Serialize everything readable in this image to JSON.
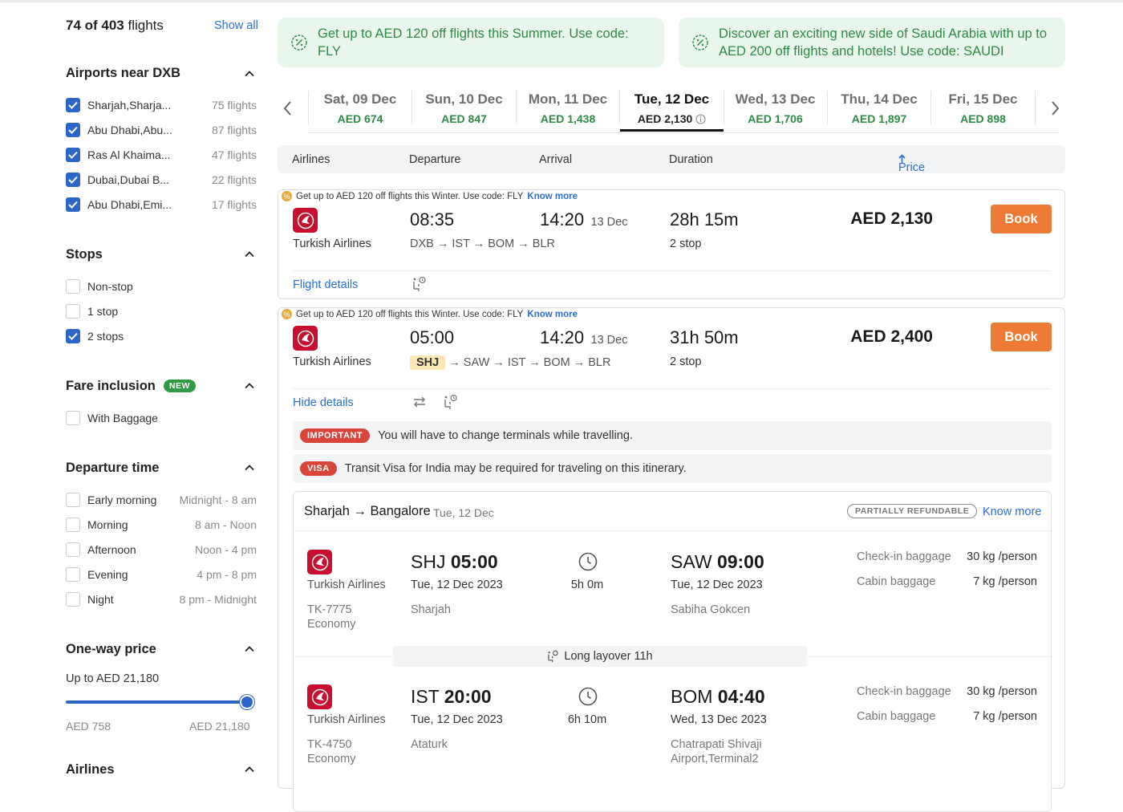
{
  "sidebar": {
    "count": {
      "shown": "74 of 403",
      "suffix": "flights"
    },
    "show_all": "Show all",
    "airports": {
      "title": "Airports near DXB",
      "items": [
        {
          "label": "Sharjah,Sharja...",
          "count": "75 flights",
          "checked": true
        },
        {
          "label": "Abu Dhabi,Abu...",
          "count": "87 flights",
          "checked": true
        },
        {
          "label": "Ras Al Khaima...",
          "count": "47 flights",
          "checked": true
        },
        {
          "label": "Dubai,Dubai B...",
          "count": "22 flights",
          "checked": true
        },
        {
          "label": "Abu Dhabi,Emi...",
          "count": "17 flights",
          "checked": true
        }
      ]
    },
    "stops": {
      "title": "Stops",
      "items": [
        {
          "label": "Non-stop",
          "checked": false
        },
        {
          "label": "1 stop",
          "checked": false
        },
        {
          "label": "2 stops",
          "checked": true
        }
      ]
    },
    "fare": {
      "title": "Fare inclusion",
      "badge": "NEW",
      "items": [
        {
          "label": "With Baggage",
          "checked": false
        }
      ]
    },
    "departure": {
      "title": "Departure time",
      "items": [
        {
          "label": "Early morning",
          "range": "Midnight - 8 am"
        },
        {
          "label": "Morning",
          "range": "8 am - Noon"
        },
        {
          "label": "Afternoon",
          "range": "Noon - 4 pm"
        },
        {
          "label": "Evening",
          "range": "4 pm - 8 pm"
        },
        {
          "label": "Night",
          "range": "8 pm - Midnight"
        }
      ]
    },
    "price": {
      "title": "One-way price",
      "upto": "Up to AED 21,180",
      "min": "AED 758",
      "max": "AED 21,180",
      "slider_fraction": 1.0
    },
    "airlines_title": "Airlines"
  },
  "promos": [
    {
      "text": "Get up to AED 120 off flights this Summer. Use code: FLY"
    },
    {
      "text": "Discover an exciting new side of Saudi Arabia with up to AED 200 off flights and hotels! Use code: SAUDI"
    }
  ],
  "dates": [
    {
      "day": "Sat, 09 Dec",
      "price": "AED 674"
    },
    {
      "day": "Sun, 10 Dec",
      "price": "AED 847"
    },
    {
      "day": "Mon, 11 Dec",
      "price": "AED 1,438"
    },
    {
      "day": "Tue, 12 Dec",
      "price": "AED 2,130",
      "selected": true
    },
    {
      "day": "Wed, 13 Dec",
      "price": "AED 1,706"
    },
    {
      "day": "Thu, 14 Dec",
      "price": "AED 1,897"
    },
    {
      "day": "Fri, 15 Dec",
      "price": "AED 898"
    }
  ],
  "header": {
    "airlines": "Airlines",
    "departure": "Departure",
    "arrival": "Arrival",
    "duration": "Duration",
    "price": "Price"
  },
  "offer": {
    "text": "Get up to AED 120 off flights this Winter. Use code: FLY",
    "link": "Know more"
  },
  "flights": [
    {
      "airline": "Turkish Airlines",
      "dep": "08:35",
      "arr": "14:20",
      "arr_date": "13 Dec",
      "route": "DXB → IST → BOM → BLR",
      "duration": "28h 15m",
      "stops": "2 stop",
      "price": "AED 2,130",
      "book": "Book",
      "details_link": "Flight details"
    },
    {
      "airline": "Turkish Airlines",
      "dep": "05:00",
      "arr": "14:20",
      "arr_date": "13 Dec",
      "route_origin": "SHJ",
      "route_rest": "→ SAW → IST → BOM → BLR",
      "duration": "31h 50m",
      "stops": "2 stop",
      "price": "AED 2,400",
      "book": "Book",
      "details_link": "Hide details",
      "notices": [
        {
          "tag": "IMPORTANT",
          "color": "#d9453b",
          "text": "You will have to change terminals while travelling."
        },
        {
          "tag": "VISA",
          "color": "#d9453b",
          "text": "Transit Visa for India may be required for traveling on this itinerary."
        }
      ],
      "itinerary": {
        "route": "Sharjah → Bangalore",
        "date": "Tue, 12 Dec",
        "refund": "PARTIALLY REFUNDABLE",
        "know_more": "Know more",
        "layover": "Long layover 11h",
        "segments": [
          {
            "airline": "Turkish Airlines",
            "flight": "TK-7775",
            "cabin": "Economy",
            "from_code": "SHJ",
            "from_time": "05:00",
            "from_date": "Tue, 12 Dec 2023",
            "from_city": "Sharjah",
            "duration": "5h 0m",
            "to_code": "SAW",
            "to_time": "09:00",
            "to_date": "Tue, 12 Dec 2023",
            "to_city": "Sabiha Gokcen",
            "checkin_label": "Check-in baggage",
            "checkin": "30 kg /person",
            "cabin_label": "Cabin baggage",
            "cabin_bag": "7 kg /person"
          },
          {
            "airline": "Turkish Airlines",
            "flight": "TK-4750",
            "cabin": "Economy",
            "from_code": "IST",
            "from_time": "20:00",
            "from_date": "Tue, 12 Dec 2023",
            "from_city": "Ataturk",
            "duration": "6h 10m",
            "to_code": "BOM",
            "to_time": "04:40",
            "to_date": "Wed, 13 Dec 2023",
            "to_city": "Chatrapati Shivaji",
            "to_city2": "Airport,Terminal2",
            "checkin_label": "Check-in baggage",
            "checkin": "30 kg /person",
            "cabin_label": "Cabin baggage",
            "cabin_bag": "7 kg /person"
          }
        ]
      }
    }
  ],
  "colors": {
    "accent_blue": "#2d66c9",
    "promo_green": "#2e8a45",
    "book_orange": "#ee7b35",
    "airline_red": "#c8102e"
  }
}
